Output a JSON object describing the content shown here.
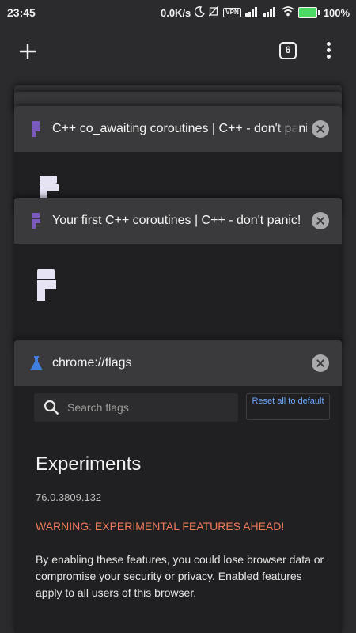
{
  "status_bar": {
    "time": "23:45",
    "speed": "0.0K/s",
    "vpn": "VPN",
    "battery": "100%"
  },
  "toolbar": {
    "tab_count": "6"
  },
  "tabs": [
    {
      "title": "C++ co_awaiting coroutines | C++ - don't panic!",
      "favicon": "p-logo-icon"
    },
    {
      "title": "Your first C++ coroutines | C++ - don't panic!",
      "favicon": "p-logo-icon"
    },
    {
      "title": "chrome://flags",
      "favicon": "flask-icon"
    }
  ],
  "flags_page": {
    "search_placeholder": "Search flags",
    "reset_label": "Reset all to default",
    "heading": "Experiments",
    "version": "76.0.3809.132",
    "warning": "WARNING: EXPERIMENTAL FEATURES AHEAD!",
    "description": "By enabling these features, you could lose browser data or compromise your security or privacy. Enabled features apply to all users of this browser."
  },
  "colors": {
    "accent_purple": "#6b4ea8",
    "flask_blue": "#3f7fe0",
    "warning_red": "#f07a5a",
    "link_blue": "#6ea8ff"
  }
}
